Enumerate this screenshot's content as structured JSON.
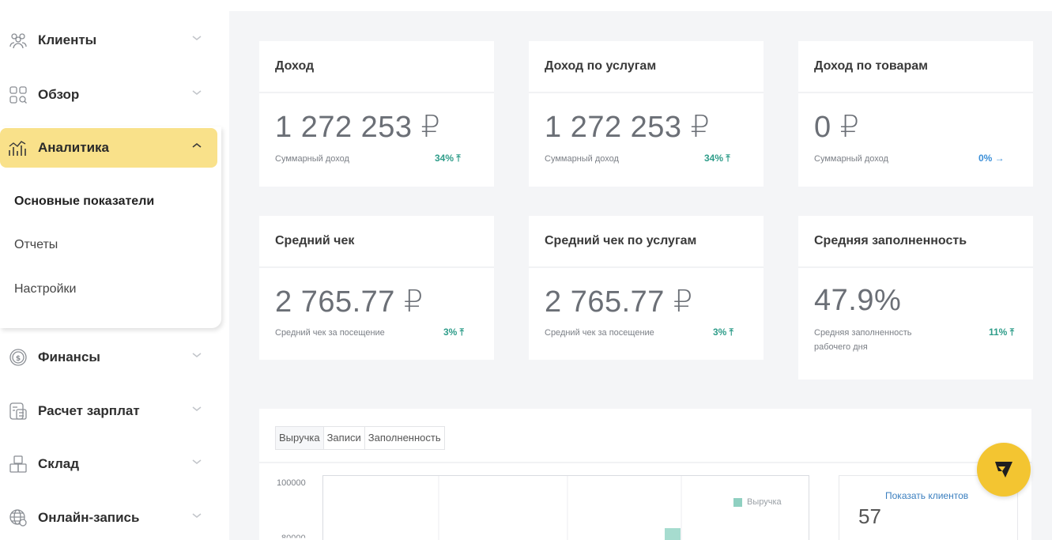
{
  "sidebar": {
    "items": [
      {
        "label": "Клиенты",
        "icon": "users-icon"
      },
      {
        "label": "Обзор",
        "icon": "grid-search-icon"
      },
      {
        "label": "Аналитика",
        "icon": "analytics-icon"
      },
      {
        "label": "Финансы",
        "icon": "coin-icon"
      },
      {
        "label": "Расчет зарплат",
        "icon": "payroll-icon"
      },
      {
        "label": "Склад",
        "icon": "boxes-icon"
      },
      {
        "label": "Онлайн-запись",
        "icon": "globe-icon"
      }
    ],
    "submenu": [
      "Основные показатели",
      "Отчеты",
      "Настройки"
    ]
  },
  "cards": [
    {
      "title": "Доход",
      "value": "1 272 253 ₽",
      "subtitle": "Суммарный доход",
      "change": "34% ⤒"
    },
    {
      "title": "Доход по услугам",
      "value": "1 272 253 ₽",
      "subtitle": "Суммарный доход",
      "change": "34% ⤒"
    },
    {
      "title": "Доход по товарам",
      "value": "0 ₽",
      "subtitle": "Суммарный доход",
      "change": "0% →"
    },
    {
      "title": "Средний чек",
      "value": "2 765.77 ₽",
      "subtitle": "Средний чек за посещение",
      "change": "3% ⤒"
    },
    {
      "title": "Средний чек по услугам",
      "value": "2 765.77 ₽",
      "subtitle": "Средний чек за посещение",
      "change": "3% ⤒"
    },
    {
      "title": "Средняя заполненность",
      "value": "47.9%",
      "subtitle": "Средняя заполненность",
      "subtitle2": "рабочего дня",
      "change": "11% ⤒"
    }
  ],
  "chart": {
    "tabs": [
      "Выручка",
      "Записи",
      "Заполненность"
    ],
    "y_top": "100000",
    "y_second": "80000",
    "legend": "Выручка",
    "show_clients": "Показать клиентов",
    "clients_count": "57"
  },
  "colors": {
    "accent_yellow": "#f9e18a",
    "teal": "#2f9d8a",
    "blue": "#3b8fd8",
    "fab": "#f3c531"
  }
}
